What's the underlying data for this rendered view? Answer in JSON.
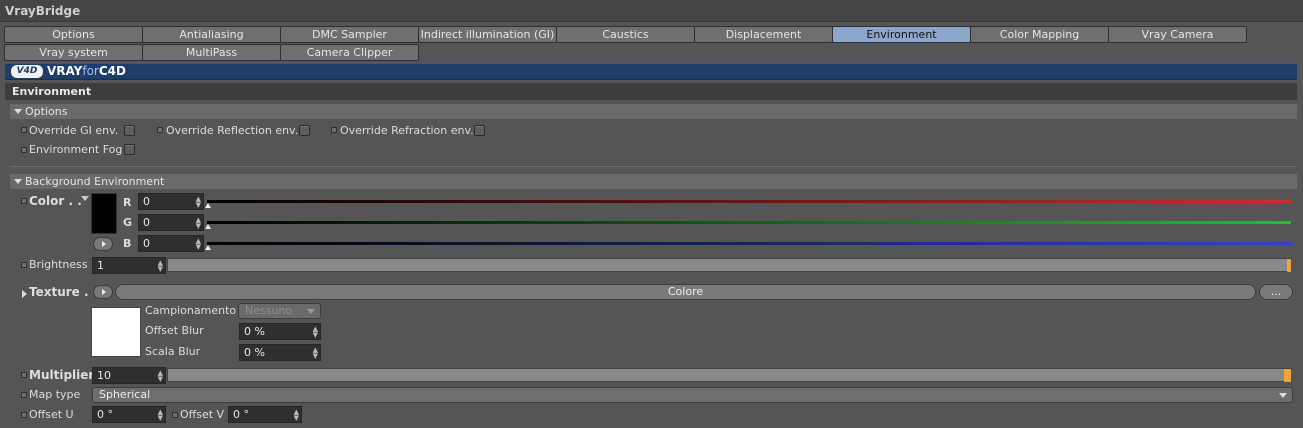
{
  "window": {
    "title": "VrayBridge"
  },
  "tabs_row1": [
    {
      "label": "Options"
    },
    {
      "label": "Antialiasing"
    },
    {
      "label": "DMC Sampler"
    },
    {
      "label": "Indirect illumination (GI)"
    },
    {
      "label": "Caustics"
    },
    {
      "label": "Displacement"
    },
    {
      "label": "Environment",
      "active": true
    },
    {
      "label": "Color Mapping"
    },
    {
      "label": "Vray Camera"
    }
  ],
  "tabs_row2": [
    {
      "label": "Vray system"
    },
    {
      "label": "MultiPass"
    },
    {
      "label": "Camera Clipper"
    }
  ],
  "banner": {
    "logo_mark": "V4D",
    "brand_vray": "VRAY",
    "brand_for": "for",
    "brand_c4d": "C4D",
    "color": "#1f3d6a"
  },
  "section": {
    "title": "Environment"
  },
  "options": {
    "group_label": "Options",
    "override_gi": "Override GI env.",
    "override_reflection": "Override Reflection env.",
    "override_refraction": "Override Refraction env.",
    "environment_fog": "Environment Fog"
  },
  "background": {
    "group_label": "Background Environment",
    "color_label": "Color . .",
    "r_label": "R",
    "r_value": "0",
    "g_label": "G",
    "g_value": "0",
    "b_label": "B",
    "b_value": "0",
    "brightness_label": "Brightness",
    "brightness_value": "1",
    "texture_label": "Texture . .",
    "texture_button": "Colore",
    "texture_more": "...",
    "campionamento_label": "Campionamento",
    "campionamento_value": "Nessuno",
    "offset_blur_label": "Offset Blur",
    "offset_blur_value": "0 %",
    "scala_blur_label": "Scala Blur",
    "scala_blur_value": "0 %",
    "multiplier_label": "Multiplier",
    "multiplier_value": "10",
    "map_type_label": "Map type",
    "map_type_value": "Spherical",
    "offset_u_label": "Offset U",
    "offset_u_value": "0 °",
    "offset_v_label": "Offset V",
    "offset_v_value": "0 °"
  },
  "colors": {
    "active_tab": "#8ea6cc",
    "slider_red": "#d8282a",
    "slider_green": "#2ab83a",
    "slider_blue": "#2848c8",
    "accent_orange": "#f2a33a"
  }
}
